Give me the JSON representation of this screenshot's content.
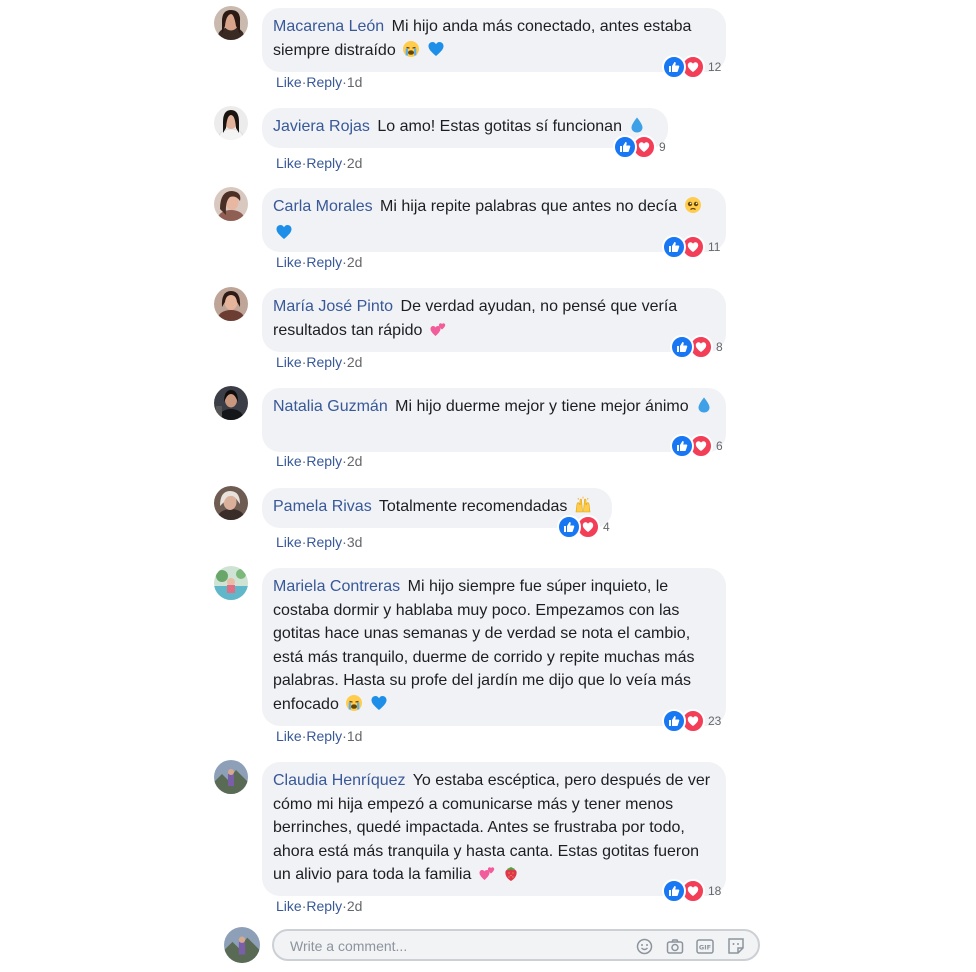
{
  "reaction_colors": {
    "like": "#1877f2",
    "love": "#f33e58"
  },
  "actions": {
    "like_label": "Like",
    "reply_label": "Reply",
    "separator": "·"
  },
  "comments": [
    {
      "author": "Macarena León",
      "text": "Mi hijo anda más conectado, antes estaba siempre distraído",
      "emojis": [
        "crying-face-icon",
        "blue-heart-icon"
      ],
      "reactions": "12",
      "time": "1d"
    },
    {
      "author": "Javiera Rojas",
      "text": "Lo amo! Estas gotitas sí funcionan",
      "emojis": [
        "droplet-icon"
      ],
      "reactions": "9",
      "time": "2d"
    },
    {
      "author": "Carla Morales",
      "text": "Mi hija repite palabras que antes no decía",
      "emojis": [
        "pleading-face-icon",
        "blue-heart-icon"
      ],
      "reactions": "11",
      "time": "2d"
    },
    {
      "author": "María José Pinto",
      "text": "De verdad ayudan, no pensé que vería resultados tan rápido",
      "emojis": [
        "two-hearts-icon"
      ],
      "reactions": "8",
      "time": "2d"
    },
    {
      "author": "Natalia Guzmán",
      "text": "Mi hijo duerme mejor y tiene mejor ánimo",
      "emojis": [
        "droplet-icon"
      ],
      "reactions": "6",
      "time": "2d"
    },
    {
      "author": "Pamela Rivas",
      "text": "Totalmente recomendadas",
      "emojis": [
        "raising-hands-icon"
      ],
      "reactions": "4",
      "time": "3d"
    },
    {
      "author": "Mariela Contreras",
      "text": "Mi hijo siempre fue súper inquieto, le costaba dormir y hablaba muy poco. Empezamos con las gotitas hace unas semanas y de verdad se nota el cambio, está más tranquilo, duerme de corrido y repite muchas más palabras. Hasta su profe del jardín me dijo que lo veía más enfocado",
      "emojis": [
        "crying-face-icon",
        "blue-heart-icon"
      ],
      "reactions": "23",
      "time": "1d"
    },
    {
      "author": "Claudia Henríquez",
      "text": "Yo estaba escéptica, pero después de ver cómo mi hija empezó a comunicarse más y tener menos berrinches, quedé impactada. Antes se frustraba por todo, ahora está más tranquila y hasta canta. Estas gotitas fueron un alivio para toda la familia",
      "emojis": [
        "two-hearts-icon",
        "strawberry-icon"
      ],
      "reactions": "18",
      "time": "2d"
    }
  ],
  "composer": {
    "placeholder": "Write a comment...",
    "tools": [
      "emoji-icon",
      "camera-icon",
      "gif-icon",
      "sticker-icon"
    ]
  }
}
